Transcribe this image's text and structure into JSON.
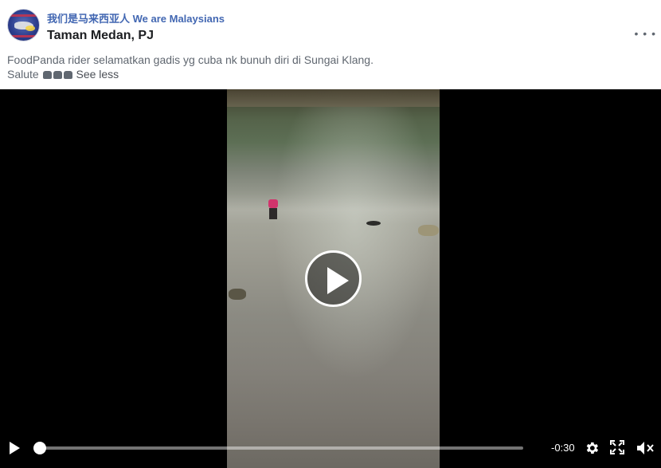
{
  "post": {
    "page_name": "我们是马来西亚人 We are Malaysians",
    "location": "Taman Medan, PJ",
    "more_label": "• • •",
    "caption_line1": "FoodPanda rider selamatkan gadis yg cuba nk bunuh diri di Sungai Klang.",
    "caption_salute": "Salute",
    "caption_emoji_icon": "thumbs-up-icon",
    "caption_emoji_count": 3,
    "see_less_label": "See less"
  },
  "video": {
    "state": "paused",
    "time_remaining": "-0:30",
    "progress": 0.0
  },
  "colors": {
    "link_blue": "#4267b2",
    "text_dark": "#1c1e21",
    "text_gray": "#606770",
    "video_bg": "#000000"
  }
}
